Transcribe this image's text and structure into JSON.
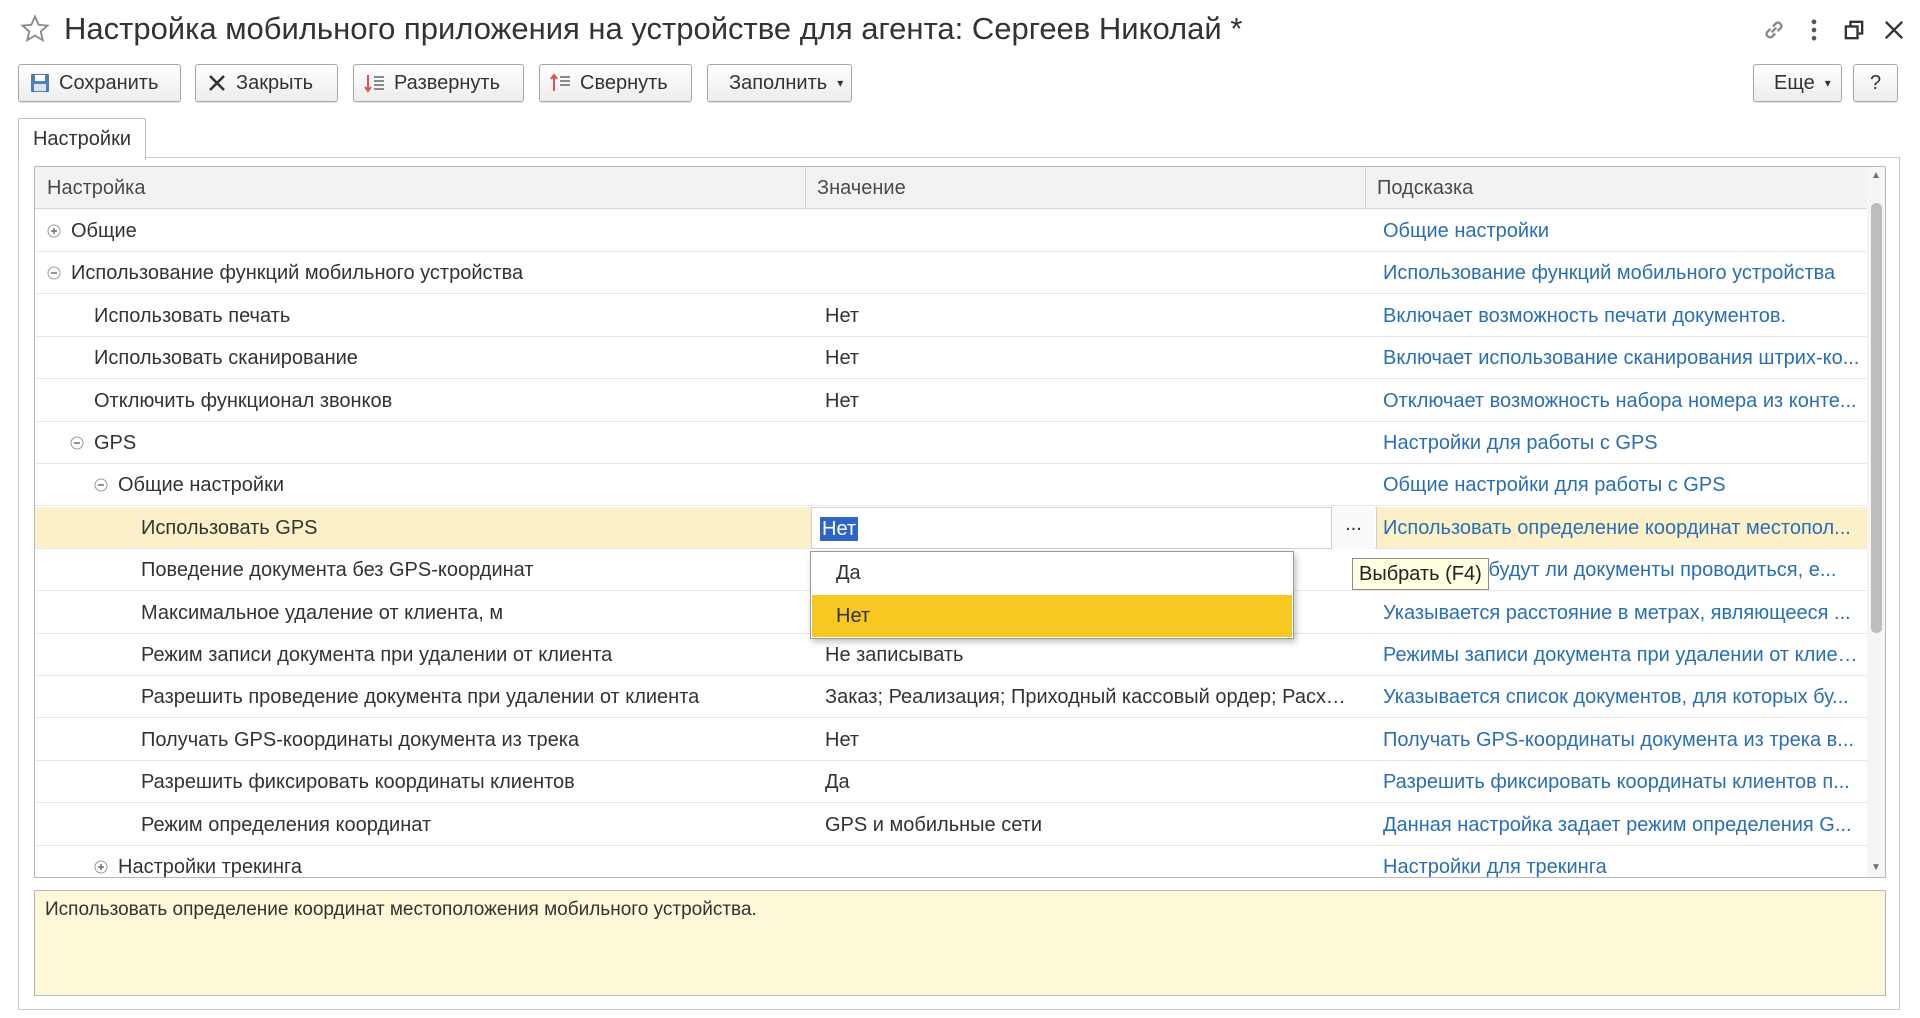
{
  "window": {
    "title": "Настройка мобильного приложения на устройстве для агента: Сергеев Николай *",
    "icons": [
      "star-icon",
      "link-icon",
      "more-vertical-icon",
      "restore-window-icon",
      "close-icon"
    ]
  },
  "toolbar": {
    "save_label": "Сохранить",
    "close_label": "Закрыть",
    "expand_label": "Развернуть",
    "collapse_label": "Свернуть",
    "fill_label": "Заполнить",
    "more_label": "Еще",
    "help_label": "?"
  },
  "tabs": [
    {
      "label": "Настройки",
      "active": true
    }
  ],
  "table": {
    "columns": [
      "Настройка",
      "Значение",
      "Подсказка"
    ],
    "rows": [
      {
        "name": "Общие",
        "value": "",
        "hint": "Общие настройки",
        "expander": "plus",
        "level": 0
      },
      {
        "name": "Использование функций мобильного устройства",
        "value": "",
        "hint": "Использование функций мобильного устройства",
        "expander": "minus",
        "level": 0
      },
      {
        "name": "Использовать печать",
        "value": "Нет",
        "hint": "Включает возможность печати документов.",
        "expander": "",
        "level": 1
      },
      {
        "name": "Использовать сканирование",
        "value": "Нет",
        "hint": "Включает использование сканирования штрих-ко...",
        "expander": "",
        "level": 1
      },
      {
        "name": "Отключить функционал звонков",
        "value": "Нет",
        "hint": "Отключает возможность набора номера из конте...",
        "expander": "",
        "level": 1
      },
      {
        "name": "GPS",
        "value": "",
        "hint": "Настройки для работы с GPS",
        "expander": "minus",
        "level": 1
      },
      {
        "name": "Общие настройки",
        "value": "",
        "hint": "Общие настройки для работы с GPS",
        "expander": "minus",
        "level": 2
      },
      {
        "name": "Использовать GPS",
        "value": "Нет",
        "hint": "Использовать определение координат местопол...",
        "expander": "",
        "level": 3,
        "active": true
      },
      {
        "name": "Поведение документа без GPS-координат",
        "value": "",
        "hint": "Указывает, будут ли документы проводиться, е...",
        "expander": "",
        "level": 3
      },
      {
        "name": "Максимальное удаление от клиента, м",
        "value": "",
        "hint": "Указывается расстояние в метрах, являющееся ...",
        "expander": "",
        "level": 3
      },
      {
        "name": "Режим записи документа при удалении от клиента",
        "value": "Не записывать",
        "hint": "Режимы записи документа при удалении от клиен...",
        "expander": "",
        "level": 3
      },
      {
        "name": "Разрешить проведение документа при удалении от клиента",
        "value": "Заказ; Реализация; Приходный кассовый ордер; Расход...",
        "hint": "Указывается список документов, для которых бу...",
        "expander": "",
        "level": 3
      },
      {
        "name": "Получать GPS-координаты документа из трека",
        "value": "Нет",
        "hint": "Получать GPS-координаты документа из трека в...",
        "expander": "",
        "level": 3
      },
      {
        "name": "Разрешить фиксировать координаты клиентов",
        "value": "Да",
        "hint": "Разрешить фиксировать координаты клиентов п...",
        "expander": "",
        "level": 3
      },
      {
        "name": "Режим определения координат",
        "value": "GPS и мобильные сети",
        "hint": "Данная настройка задает режим определения G...",
        "expander": "",
        "level": 3
      },
      {
        "name": "Настройки трекинга",
        "value": "",
        "hint": "Настройки для трекинга",
        "expander": "plus",
        "level": 2
      }
    ],
    "edit_button_label": "..."
  },
  "dropdown": {
    "options": [
      "Да",
      "Нет"
    ],
    "selected": "Нет"
  },
  "tooltip": "Выбрать (F4)",
  "hint_text": "Использовать определение координат местоположения мобильного устройства.",
  "colors": {
    "link": "#2a6fb3",
    "active_row": "#fbf0c8",
    "dropdown_selected": "#f7c822",
    "selection": "#2e64c6",
    "hint_background": "#fdf8d8"
  }
}
